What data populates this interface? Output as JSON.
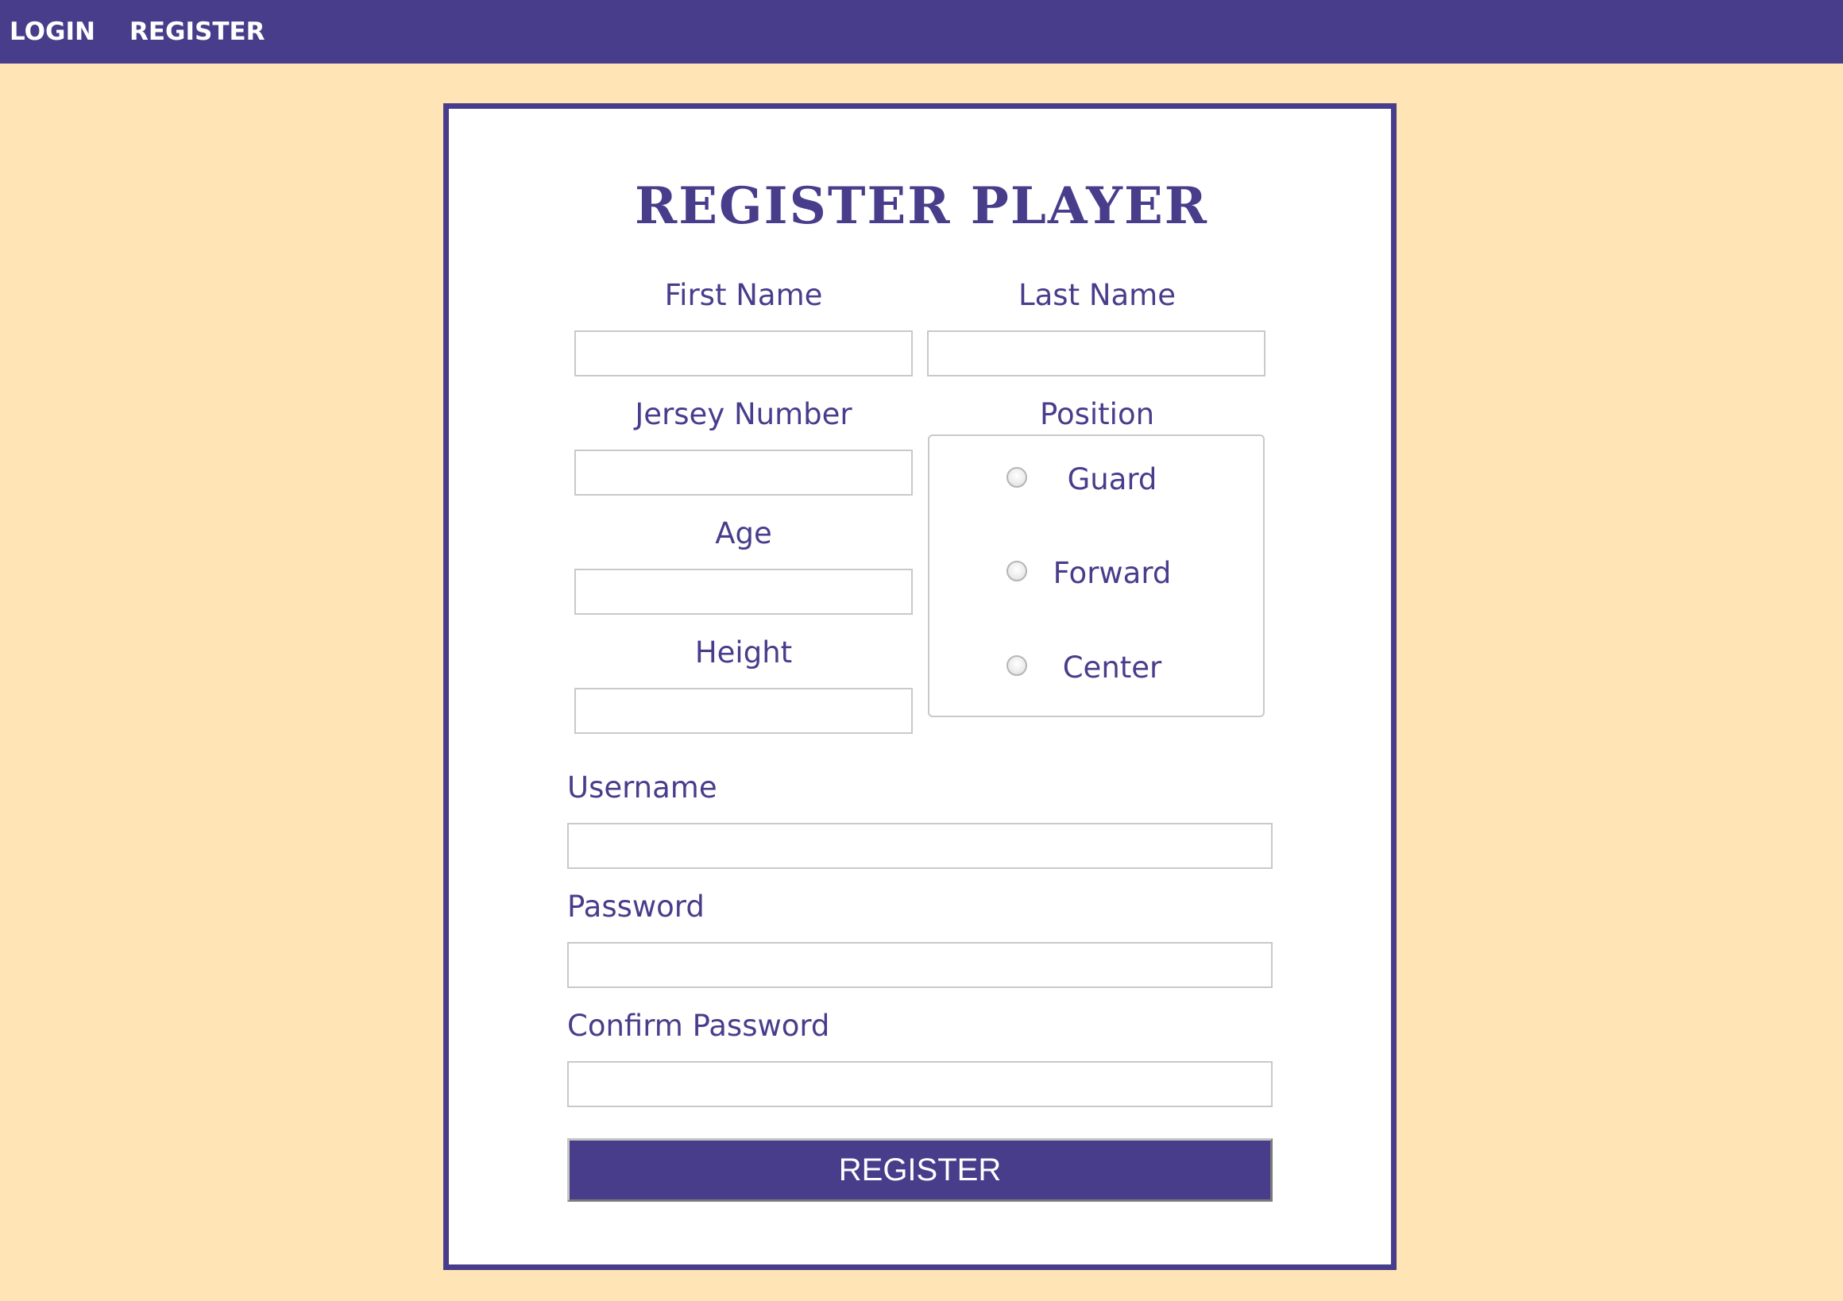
{
  "nav": {
    "login": "LOGIN",
    "register": "REGISTER"
  },
  "form": {
    "title": "REGISTER PLAYER",
    "first_name_label": "First Name",
    "last_name_label": "Last Name",
    "jersey_number_label": "Jersey Number",
    "position_label": "Position",
    "age_label": "Age",
    "height_label": "Height",
    "position_options": [
      "Guard",
      "Forward",
      "Center"
    ],
    "username_label": "Username",
    "password_label": "Password",
    "confirm_password_label": "Confirm Password",
    "submit_label": "REGISTER",
    "values": {
      "first_name": "",
      "last_name": "",
      "jersey_number": "",
      "age": "",
      "height": "",
      "username": "",
      "password": "",
      "confirm_password": ""
    }
  },
  "colors": {
    "primary": "#483D8B",
    "background": "#FFE4B6",
    "card": "#FFFFFF",
    "input_border": "#C9C9C9"
  }
}
